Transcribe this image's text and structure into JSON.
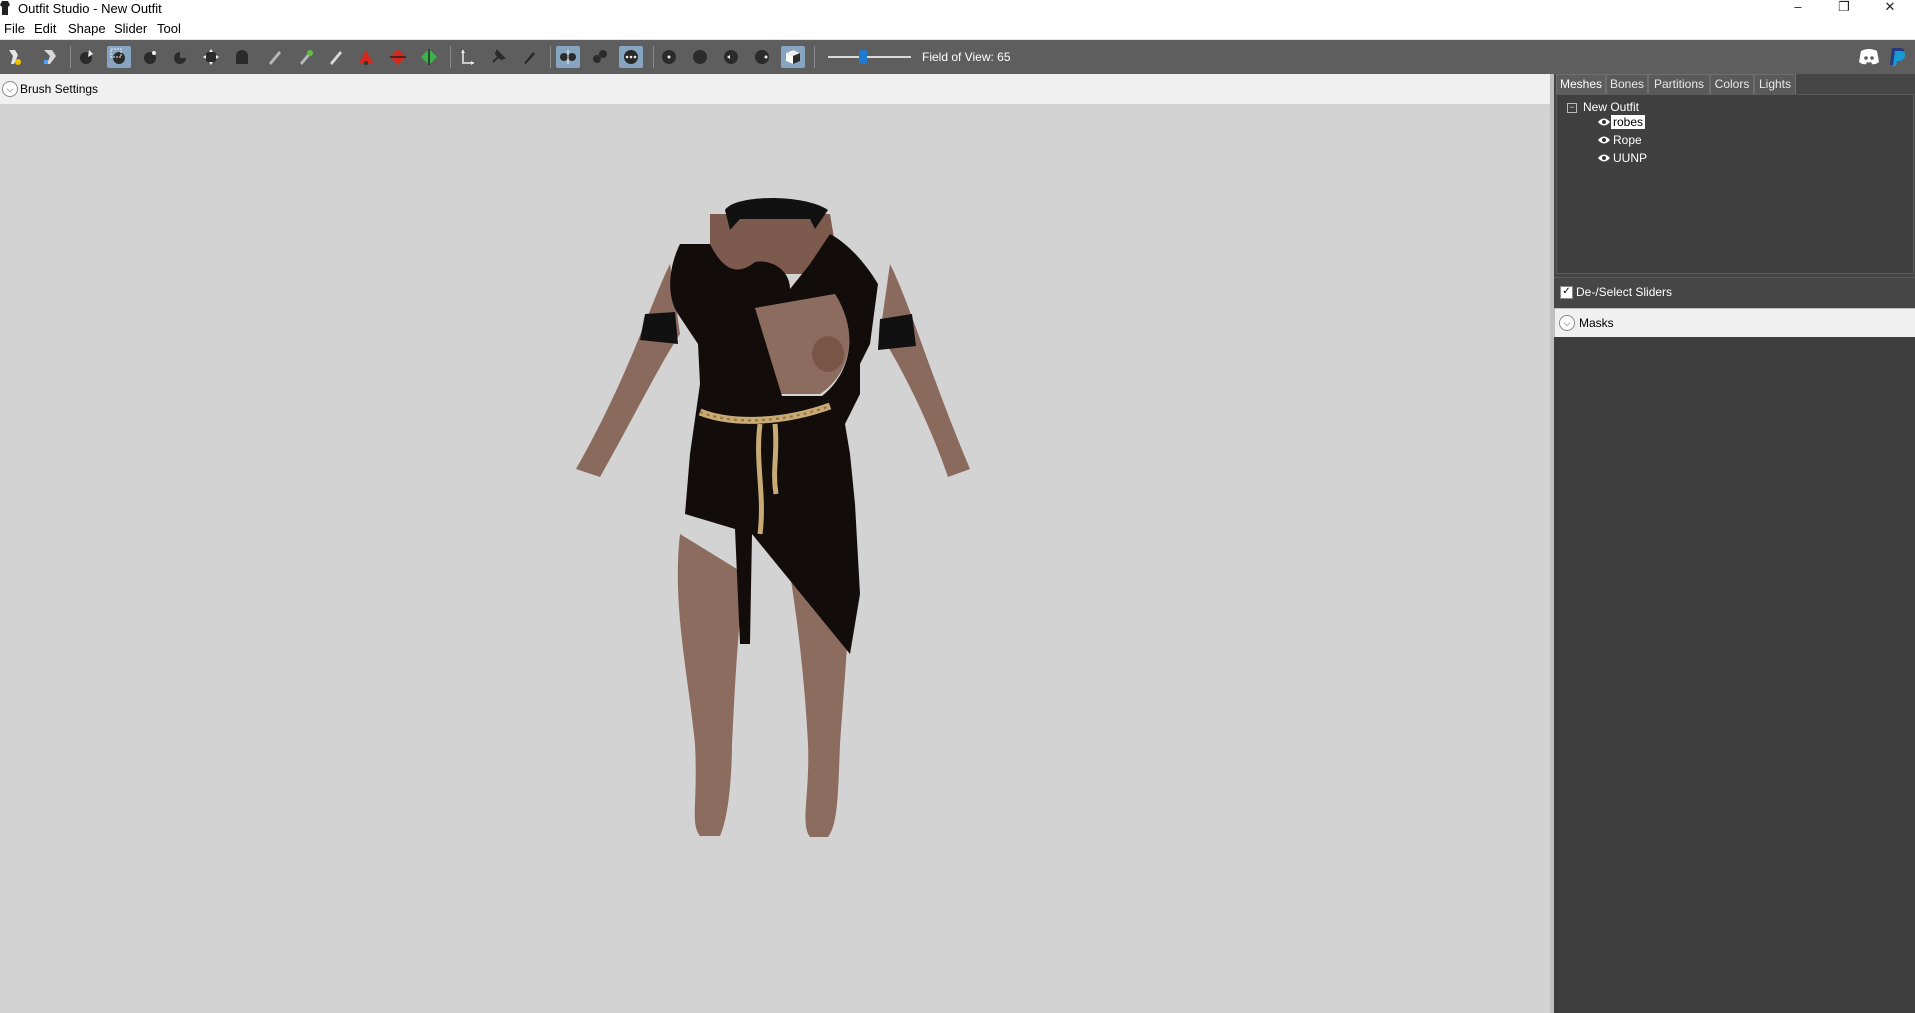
{
  "window": {
    "title": "Outfit Studio - New Outfit",
    "minimize_glyph": "–",
    "restore_glyph": "❐",
    "close_glyph": "✕"
  },
  "menu": [
    "File",
    "Edit",
    "Shape",
    "Slider",
    "Tool"
  ],
  "toolbar": {
    "fov_label": "Field of View: 65",
    "fov_value": 65,
    "slider_position_fraction": 0.42
  },
  "viewport": {
    "brush_settings_label": "Brush Settings",
    "background_color": "#d3d3d3"
  },
  "panel": {
    "tabs": [
      {
        "label": "Meshes",
        "active": true
      },
      {
        "label": "Bones",
        "active": false
      },
      {
        "label": "Partitions",
        "active": false
      },
      {
        "label": "Colors",
        "active": false
      },
      {
        "label": "Lights",
        "active": false
      }
    ],
    "tree": {
      "root": "New Outfit",
      "items": [
        {
          "label": "robes",
          "selected": true
        },
        {
          "label": "Rope",
          "selected": false
        },
        {
          "label": "UUNP",
          "selected": false
        }
      ]
    },
    "sliders_label": "De-/Select Sliders",
    "sliders_checked": true,
    "masks_label": "Masks"
  },
  "colors": {
    "toolbar_bg": "#5e5e5e",
    "panel_bg": "#464646",
    "accent": "#1f7bd1"
  }
}
